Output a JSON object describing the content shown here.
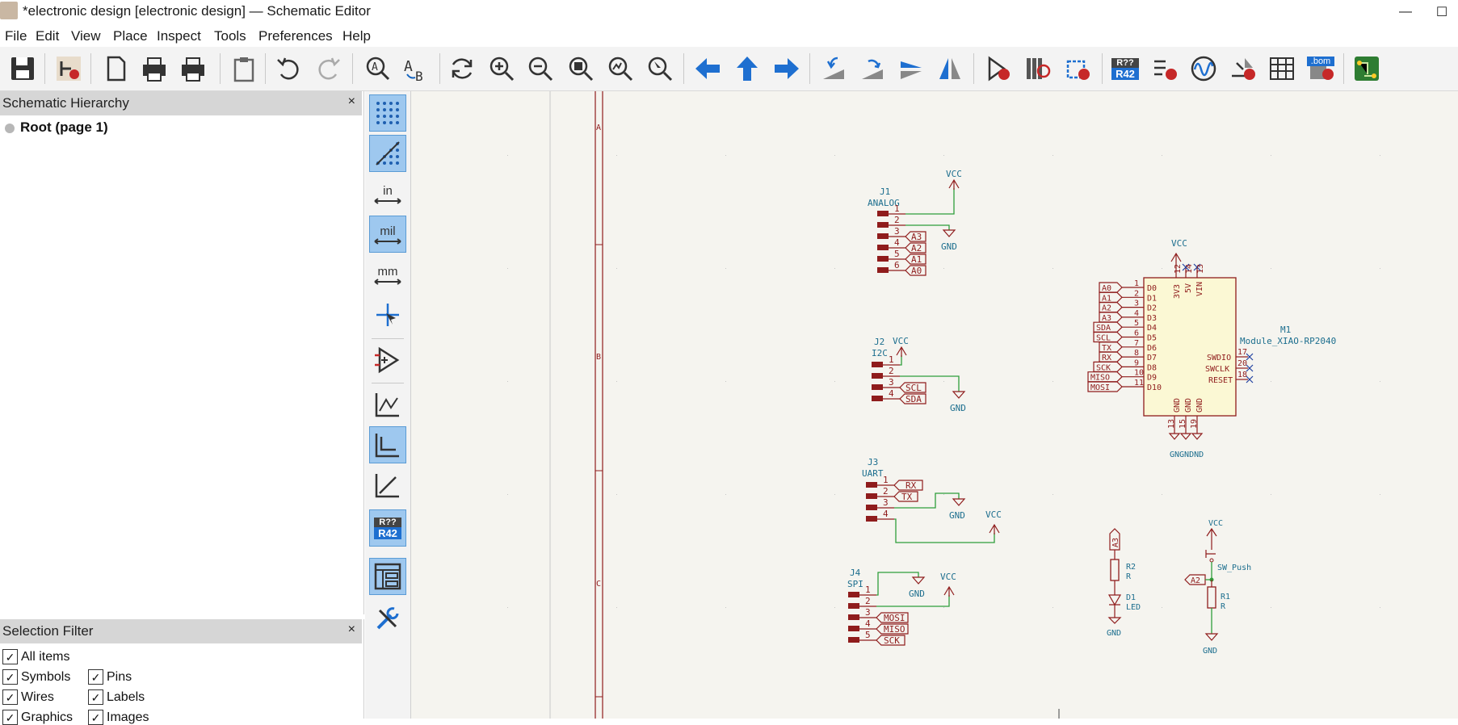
{
  "window": {
    "title": "*electronic design [electronic design] — Schematic Editor",
    "minimize": "—",
    "maximize": "☐"
  },
  "menu": [
    "File",
    "Edit",
    "View",
    "Place",
    "Inspect",
    "Tools",
    "Preferences",
    "Help"
  ],
  "hierarchy": {
    "title": "Schematic Hierarchy",
    "close": "×",
    "root": "Root (page 1)"
  },
  "selection_filter": {
    "title": "Selection Filter",
    "close": "×",
    "items": [
      {
        "label": "All items",
        "checked": true
      },
      {
        "label": "Symbols",
        "checked": true
      },
      {
        "label": "Pins",
        "checked": true
      },
      {
        "label": "Wires",
        "checked": true
      },
      {
        "label": "Labels",
        "checked": true
      },
      {
        "label": "Graphics",
        "checked": true
      },
      {
        "label": "Images",
        "checked": true
      }
    ]
  },
  "left_toolbar": {
    "units_in": "in",
    "units_mil": "mil",
    "units_mm": "mm",
    "annotate_top": "R??",
    "annotate_bottom": "R42"
  },
  "toolbar": {
    "annotate_top": "R??",
    "annotate_bottom": "R42",
    "bom_label": ".bom"
  },
  "colors": {
    "wire": "#2e9e3a",
    "symbol": "#8f1c1c",
    "text": "#1c6e8e",
    "canvas": "#f5f4ef",
    "active": "#9ec8ef"
  },
  "schematic": {
    "border_letters": [
      "A",
      "B",
      "C"
    ],
    "power_vcc": "VCC",
    "power_gnd": "GND",
    "j1": {
      "ref": "J1",
      "value": "ANALOG",
      "pins": [
        "1",
        "2",
        "3",
        "4",
        "5",
        "6"
      ],
      "labels": [
        "A3",
        "A2",
        "A1",
        "A0"
      ]
    },
    "j2": {
      "ref": "J2",
      "value": "I2C",
      "pins": [
        "1",
        "2",
        "3",
        "4"
      ],
      "labels": [
        "SCL",
        "SDA"
      ]
    },
    "j3": {
      "ref": "J3",
      "value": "UART",
      "pins": [
        "1",
        "2",
        "3",
        "4"
      ],
      "labels": [
        "RX",
        "TX"
      ]
    },
    "j4": {
      "ref": "J4",
      "value": "SPI",
      "pins": [
        "1",
        "2",
        "3",
        "4",
        "5"
      ],
      "labels": [
        "MOSI",
        "MISO",
        "SCK"
      ]
    },
    "m1": {
      "ref": "M1",
      "value": "Module_XIAO-RP2040",
      "left_labels": [
        "A0",
        "A1",
        "A2",
        "A3",
        "SDA",
        "SCL",
        "TX",
        "RX",
        "SCK",
        "MISO",
        "MOSI"
      ],
      "left_pin_nums": [
        "1",
        "2",
        "3",
        "4",
        "5",
        "6",
        "7",
        "8",
        "9",
        "10",
        "11"
      ],
      "left_pin_names": [
        "D0",
        "D1",
        "D2",
        "D3",
        "D4",
        "D5",
        "D6",
        "D7",
        "D8",
        "D9",
        "D10"
      ],
      "top_pin_names": [
        "3V3",
        "5V",
        "VIN"
      ],
      "top_pin_nums": [
        "12",
        "14",
        "13"
      ],
      "right_pin_names": [
        "SWDIO",
        "SWCLK",
        "RESET"
      ],
      "right_pin_nums": [
        "17",
        "20",
        "18"
      ],
      "bottom_pin_names": [
        "GND",
        "GND",
        "GND"
      ],
      "bottom_pin_nums": [
        "13",
        "15",
        "19"
      ],
      "bottom_net": "GNGNDND"
    },
    "r2": {
      "ref": "R2",
      "value": "R",
      "label": "A3"
    },
    "d1": {
      "ref": "D1",
      "value": "LED"
    },
    "sw": {
      "ref": "SW_Push",
      "label": "A2"
    },
    "r1": {
      "ref": "R1",
      "value": "R"
    }
  }
}
